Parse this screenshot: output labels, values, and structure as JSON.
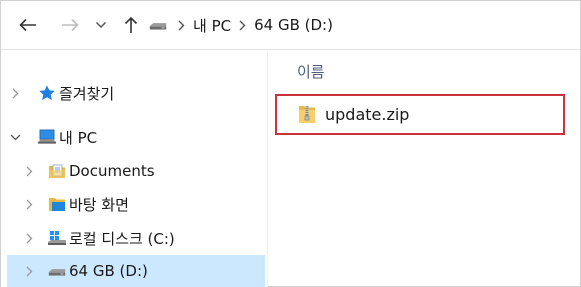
{
  "toolbar": {
    "back_icon": "arrow-left-icon",
    "forward_icon": "arrow-right-icon",
    "recent_icon": "chevron-down-icon",
    "up_icon": "arrow-up-icon"
  },
  "breadcrumb": {
    "root_icon": "drive-icon",
    "items": [
      {
        "label": "내 PC"
      },
      {
        "label": "64 GB (D:)"
      }
    ]
  },
  "sidebar": {
    "items": [
      {
        "label": "즐겨찾기",
        "icon": "star-icon",
        "expanded": false,
        "level": 0
      },
      {
        "label": "내 PC",
        "icon": "computer-icon",
        "expanded": true,
        "level": 0
      },
      {
        "label": "Documents",
        "icon": "documents-folder-icon",
        "expanded": false,
        "level": 1
      },
      {
        "label": "바탕 화면",
        "icon": "desktop-folder-icon",
        "expanded": false,
        "level": 1
      },
      {
        "label": "로컬 디스크 (C:)",
        "icon": "windows-drive-icon",
        "expanded": false,
        "level": 1
      },
      {
        "label": "64 GB (D:)",
        "icon": "usb-drive-icon",
        "expanded": false,
        "level": 1,
        "selected": true
      }
    ]
  },
  "content": {
    "column_header": "이름",
    "files": [
      {
        "name": "update.zip",
        "icon": "zip-folder-icon"
      }
    ]
  },
  "colors": {
    "selection": "#cce8ff",
    "highlight_border": "#c8313e",
    "header_text": "#4d6082"
  }
}
